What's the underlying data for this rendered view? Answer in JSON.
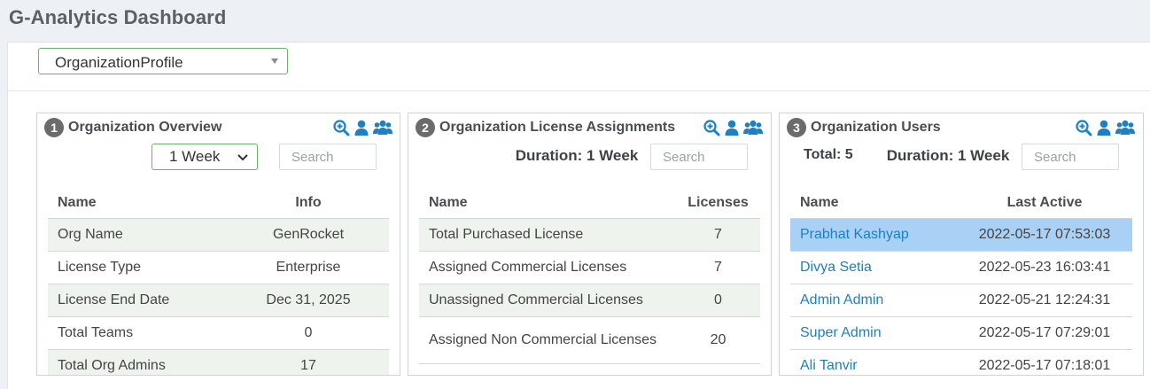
{
  "app": {
    "title": "G-Analytics Dashboard"
  },
  "selector": {
    "value": "OrganizationProfile"
  },
  "colors": {
    "accent_green": "#66b266",
    "link_blue": "#1d7fc4",
    "selected_row": "#a9d0f5",
    "stripe": "#eff3ee",
    "icon_blue": "#1d7fc4"
  },
  "panels": [
    {
      "number": "1",
      "title": "Organization Overview",
      "duration_select": "1 Week",
      "search_placeholder": "Search",
      "columns": [
        "Name",
        "Info"
      ],
      "rows": [
        {
          "name": "Org Name",
          "value": "GenRocket"
        },
        {
          "name": "License Type",
          "value": "Enterprise"
        },
        {
          "name": "License End Date",
          "value": "Dec 31, 2025"
        },
        {
          "name": "Total Teams",
          "value": "0"
        },
        {
          "name": "Total Org Admins",
          "value": "17"
        }
      ]
    },
    {
      "number": "2",
      "title": "Organization License Assignments",
      "duration_label": "Duration: 1 Week",
      "search_placeholder": "Search",
      "columns": [
        "Name",
        "Licenses"
      ],
      "rows": [
        {
          "name": "Total Purchased License",
          "value": "7"
        },
        {
          "name": "Assigned Commercial Licenses",
          "value": "7"
        },
        {
          "name": "Unassigned Commercial Licenses",
          "value": "0"
        },
        {
          "name": "Assigned Non Commercial Licenses",
          "value": "20"
        }
      ]
    },
    {
      "number": "3",
      "title": "Organization Users",
      "total_label": "Total: 5",
      "duration_label": "Duration: 1 Week",
      "search_placeholder": "Search",
      "columns": [
        "Name",
        "Last Active"
      ],
      "rows": [
        {
          "name": "Prabhat Kashyap",
          "value": "2022-05-17 07:53:03"
        },
        {
          "name": "Divya Setia",
          "value": "2022-05-23 16:03:41"
        },
        {
          "name": "Admin Admin",
          "value": "2022-05-21 12:24:31"
        },
        {
          "name": "Super Admin",
          "value": "2022-05-17 07:29:01"
        },
        {
          "name": "Ali Tanvir",
          "value": "2022-05-17 07:18:01"
        }
      ]
    }
  ],
  "icons": [
    "zoom-in-icon",
    "user-icon",
    "users-group-icon",
    "chevron-down-icon",
    "caret-down-icon"
  ]
}
